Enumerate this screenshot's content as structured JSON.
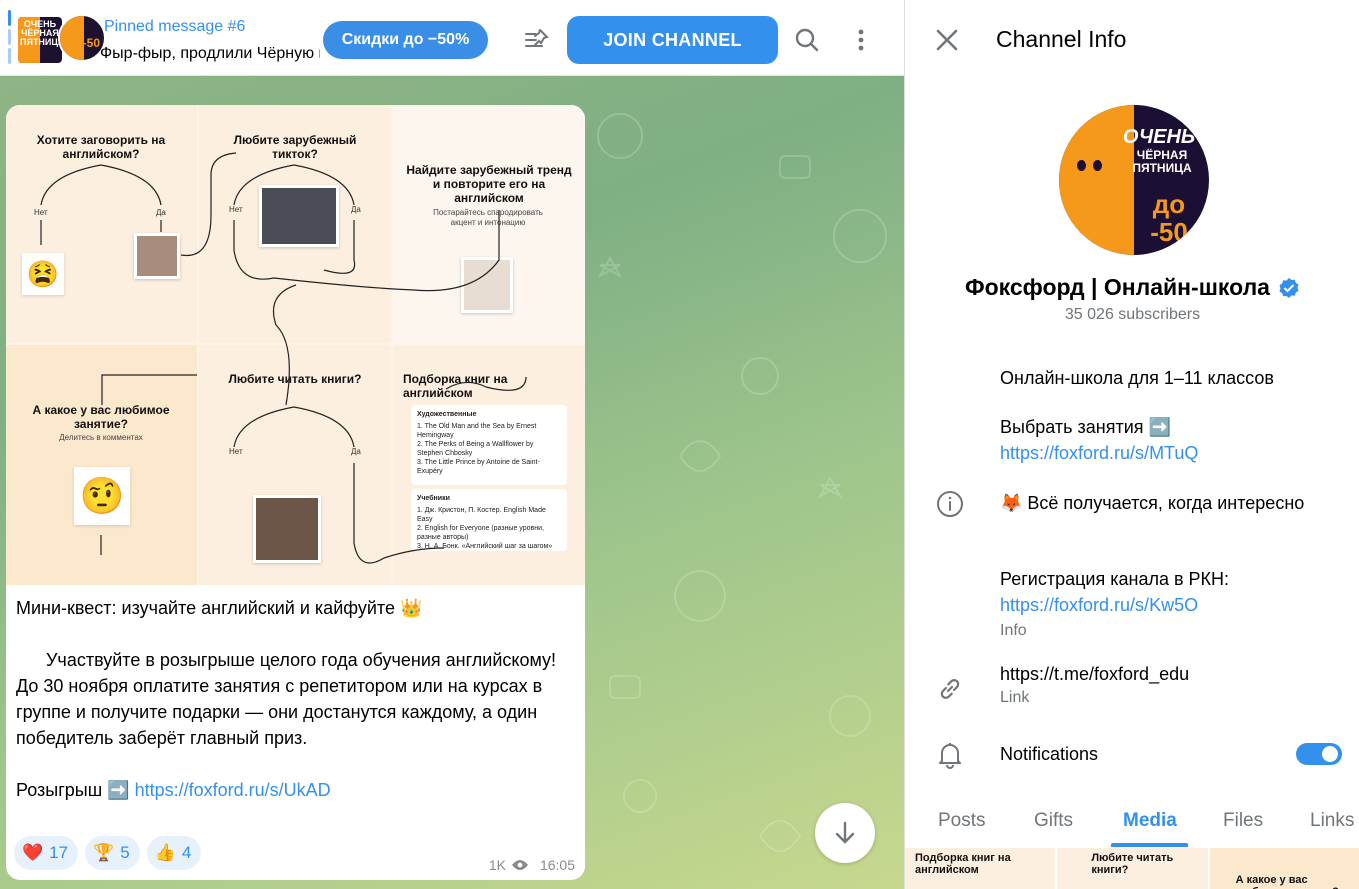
{
  "header": {
    "pinned_title": "Pinned message #6",
    "pinned_text": "Фыр-фыр, продлили Чёрную пятницу",
    "pin_thumb_text": "ОЧЕНЬ ЧЁРНАЯ ПЯТНИЦА",
    "avatar_text": "до -50",
    "promo_button": "Скидки до −50%",
    "join_button": "JOIN CHANNEL"
  },
  "post": {
    "media": {
      "cells": [
        {
          "title": "Хотите заговорить на английском?",
          "no": "Нет",
          "yes": "Да"
        },
        {
          "title": "Любите зарубежный тикток?",
          "no": "Нет",
          "yes": "Да"
        },
        {
          "title": "Найдите зарубежный тренд и повторите его на английском",
          "sub": "Постарайтесь спародировать акцент и интонацию"
        },
        {
          "title": "А какое у вас любимое занятие?",
          "sub": "Делитесь в комментах"
        },
        {
          "title": "Любите читать книги?",
          "no": "Нет",
          "yes": "Да"
        },
        {
          "title": "Подборка книг на английском"
        }
      ],
      "books_fiction_title": "Художественные",
      "books_fiction": [
        "1. The Old Man and the Sea by Ernest Hemingway",
        "2. The Perks of Being a Wallflower by Stephen Chbosky",
        "3. The Little Prince by Antoine de Saint-Exupéry"
      ],
      "books_study_title": "Учебники",
      "books_study": [
        "1. Дж. Кристон, П. Костер. English Made Easy",
        "2. English for Everyone (разные уровни, разные авторы)",
        "3. Н. А. Бонк. «Английский шаг за шагом»"
      ]
    },
    "title": "Мини-квест: изучайте английский и кайфуйте 👑",
    "body": "Участвуйте в розыгрыше целого года обучения английскому! До 30 ноября оплатите занятия с репетитором или на курсах в группе и получите подарки — они достанутся каждому, а один победитель заберёт главный приз.",
    "giveaway_label": "Розыгрыш ➡️",
    "giveaway_link": "https://foxford.ru/s/UkAD",
    "reactions": [
      {
        "emoji": "❤️",
        "count": "17"
      },
      {
        "emoji": "🏆",
        "count": "5"
      },
      {
        "emoji": "👍",
        "count": "4"
      }
    ],
    "views": "1K",
    "time": "16:05"
  },
  "panel": {
    "title": "Channel Info",
    "avatar_line1": "ОЧЕНЬ",
    "avatar_line2": "ЧЁРНАЯ ПЯТНИЦА",
    "avatar_line3": "до -50",
    "channel_name": "Фоксфорд | Онлайн-школа",
    "subscribers": "35 026 subscribers",
    "desc_line1": "Онлайн-школа для 1–11 классов",
    "desc_line2_label": "Выбрать занятия ➡️",
    "desc_line2_link": "https://foxford.ru/s/MTuQ",
    "desc_line3": "🦊 Всё получается, когда интересно",
    "desc_line4_label": "Регистрация канала в РКН:",
    "desc_line4_link": "https://foxford.ru/s/Kw5O",
    "info_caption": "Info",
    "link_value": "https://t.me/foxford_edu",
    "link_caption": "Link",
    "notifications_label": "Notifications",
    "notifications_on": true,
    "tabs": [
      "Posts",
      "Gifts",
      "Media",
      "Files",
      "Links"
    ],
    "active_tab": "Media",
    "thumbs": [
      "Подборка книг на английском",
      "Любите читать книги?",
      "А какое у вас любимое занятие?"
    ]
  },
  "colors": {
    "accent": "#3390ec",
    "fox_orange": "#f6991b",
    "avatar_dark": "#1b0f33"
  }
}
